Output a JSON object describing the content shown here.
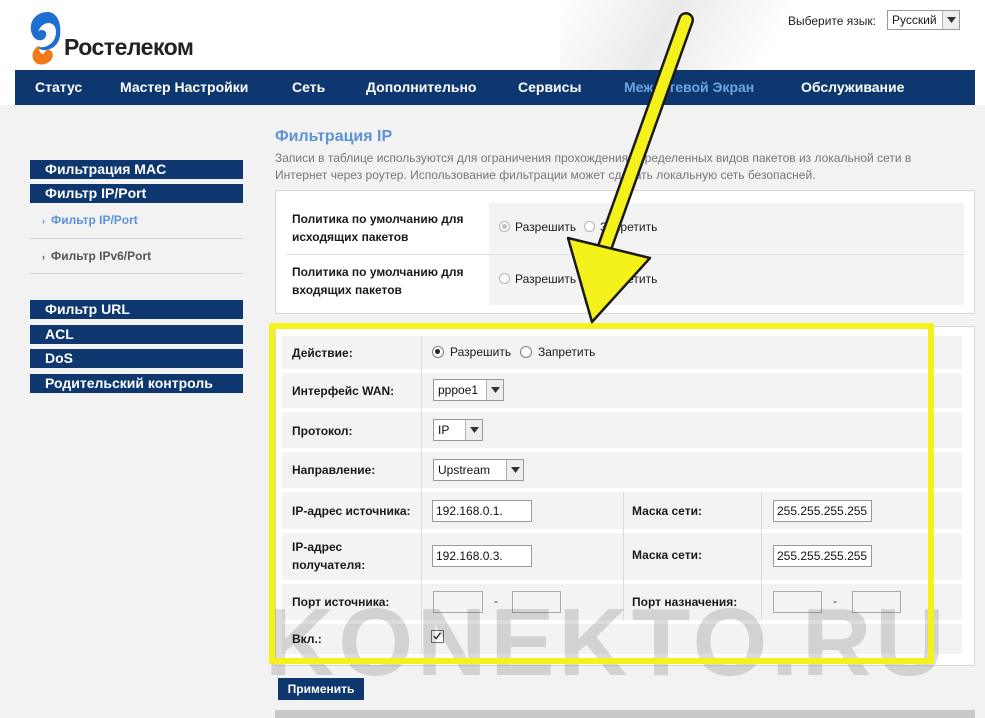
{
  "brand": {
    "name": "Ростелеком",
    "colors": {
      "nav": "#0e3770",
      "accent": "#5b93d6",
      "highlight": "#f4f21a"
    }
  },
  "language": {
    "label": "Выберите язык:",
    "selected": "Русский"
  },
  "nav": {
    "items": [
      {
        "label": "Статус"
      },
      {
        "label": "Мастер Настройки"
      },
      {
        "label": "Сеть"
      },
      {
        "label": "Дополнительно"
      },
      {
        "label": "Сервисы"
      },
      {
        "label": "Межсетевой Экран",
        "active": true
      },
      {
        "label": "Обслуживание"
      }
    ]
  },
  "sidebar": {
    "sections": [
      {
        "label": "Фильтрация MAC"
      },
      {
        "label": "Фильтр IP/Port"
      },
      {
        "label": "Фильтр URL"
      },
      {
        "label": "ACL"
      },
      {
        "label": "DoS"
      },
      {
        "label": "Родительский контроль"
      }
    ],
    "subitems": [
      {
        "label": "Фильтр IP/Port",
        "active": true
      },
      {
        "label": "Фильтр IPv6/Port",
        "active": false
      }
    ]
  },
  "page": {
    "title": "Фильтрация IP",
    "description": "Записи в таблице используются для ограничения прохождения определенных видов пакетов из локальной сети в Интернет через роутер. Использование фильтрации может сделать локальную сеть безопасней."
  },
  "policy": {
    "outgoing_label": "Политика по умолчанию для исходящих пакетов",
    "incoming_label": "Политика по умолчанию для входящих пакетов",
    "allow": "Разрешить",
    "deny": "Запретить",
    "outgoing_selected": "allow",
    "incoming_selected": "deny"
  },
  "form": {
    "action_label": "Действие:",
    "action_allow": "Разрешить",
    "action_deny": "Запретить",
    "action_selected": "allow",
    "wan_label": "Интерфейс WAN:",
    "wan_value": "pppoe1",
    "protocol_label": "Протокол:",
    "protocol_value": "IP",
    "direction_label": "Направление:",
    "direction_value": "Upstream",
    "src_ip_label": "IP-адрес источника:",
    "src_ip_value": "192.168.0.1.",
    "src_mask_label": "Маска сети:",
    "src_mask_value": "255.255.255.255",
    "dst_ip_label": "IP-адрес получателя:",
    "dst_ip_value": "192.168.0.3.",
    "dst_mask_label": "Маска сети:",
    "dst_mask_value": "255.255.255.255",
    "src_port_label": "Порт источника:",
    "dst_port_label": "Порт назначения:",
    "port_separator": "-",
    "enabled_label": "Вкл.:",
    "enabled": true
  },
  "apply_label": "Применить",
  "watermark": "KONEKTO.RU"
}
